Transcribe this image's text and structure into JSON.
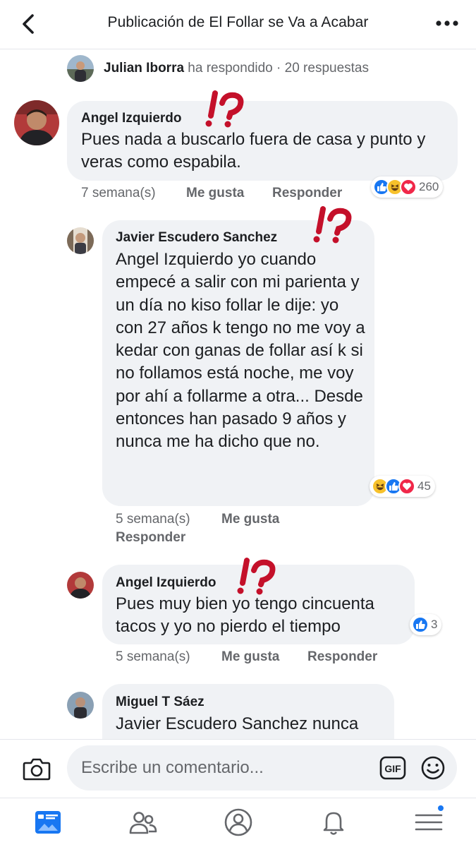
{
  "header": {
    "title": "Publicación de El Follar se Va a Acabar",
    "back_icon": "chevron-left-icon",
    "more_icon": "more-horizontal-icon"
  },
  "replied": {
    "name": "Julian Iborra",
    "action": " ha respondido",
    "separator": " · ",
    "count_text": "20 respuestas"
  },
  "comments": [
    {
      "author": "Angel Izquierdo",
      "text": "Pues nada a buscarlo fuera de casa y punto y veras como espabila.",
      "time": "7 semana(s)",
      "like_label": "Me gusta",
      "reply_label": "Responder",
      "reaction_count": "260",
      "reactions": [
        "like",
        "haha",
        "love"
      ]
    },
    {
      "author": "Javier Escudero Sanchez",
      "text": "Angel Izquierdo yo cuando empecé a salir con mi parienta y un día no kiso follar le dije: yo con 27 años k tengo no me voy a kedar con ganas de follar así k si no follamos está noche, me voy por ahí a follarme a otra... Desde entonces han pasado 9 años y nunca me ha dicho que no.",
      "time": "5 semana(s)",
      "like_label": "Me gusta",
      "reply_label": "Responder",
      "reaction_count": "45",
      "reactions": [
        "haha",
        "like",
        "love"
      ]
    },
    {
      "author": "Angel Izquierdo",
      "text": "Pues muy bien yo tengo cincuenta tacos y yo no pierdo el tiempo",
      "time": "5 semana(s)",
      "like_label": "Me gusta",
      "reply_label": "Responder",
      "reaction_count": "3",
      "reactions": [
        "like"
      ]
    },
    {
      "author": "Miguel T Sáez",
      "text": "Javier Escudero Sanchez nunca"
    }
  ],
  "composer": {
    "placeholder": "Escribe un comentario...",
    "camera_icon": "camera-icon",
    "gif_label": "GIF",
    "emoji_icon": "smiley-icon"
  },
  "tabbar": {
    "items": [
      "news-feed-icon",
      "friends-icon",
      "profile-icon",
      "notifications-icon",
      "menu-icon"
    ],
    "active": "news-feed-icon"
  },
  "colors": {
    "brand_blue": "#1877f2",
    "bubble_gray": "#f0f2f5",
    "secondary_text": "#65676b",
    "annotation_red": "#c4102a"
  }
}
